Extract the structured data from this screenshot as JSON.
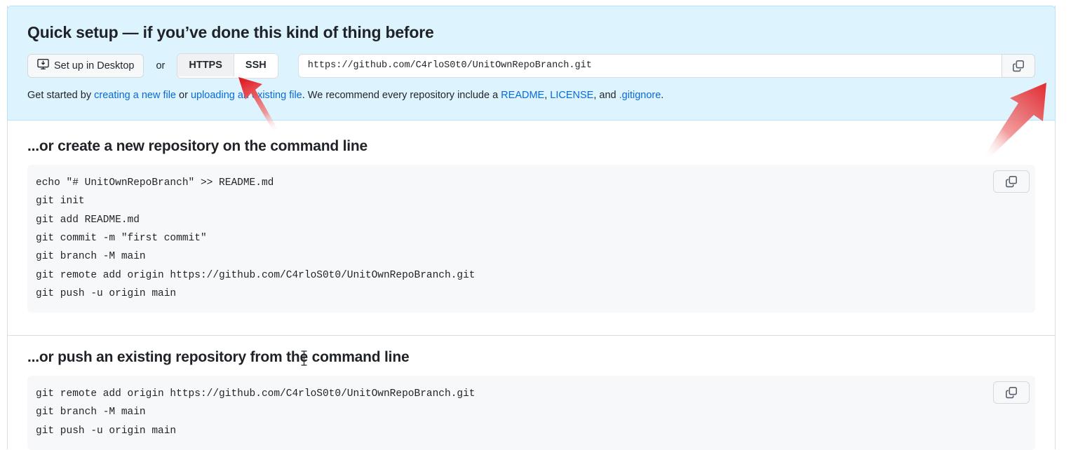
{
  "quick_setup": {
    "title": "Quick setup — if you’ve done this kind of thing before",
    "desktop_button": {
      "label": "Set up in Desktop",
      "icon": "desktop-download-icon"
    },
    "or_label": "or",
    "protocol_toggle": {
      "options": [
        "HTTPS",
        "SSH"
      ],
      "selected": "HTTPS"
    },
    "clone_url": {
      "value": "https://github.com/C4rloS0t0/UnitOwnRepoBranch.git",
      "placeholder": "https://github.com/"
    },
    "copy_icon": "copy-icon",
    "hint": {
      "lead": "Get started by ",
      "link_create": "creating a new file",
      "mid_1": " or ",
      "link_upload": "uploading an existing file",
      "mid_2": ". We recommend every repository include a ",
      "link_readme": "README",
      "comma_1": ", ",
      "link_license": "LICENSE",
      "mid_3": ", and ",
      "link_gitignore": ".gitignore",
      "end": "."
    }
  },
  "sections": [
    {
      "title": "...or create a new repository on the command line",
      "copy_icon": "copy-icon",
      "lines": [
        "echo \"# UnitOwnRepoBranch\" >> README.md",
        "git init",
        "git add README.md",
        "git commit -m \"first commit\"",
        "git branch -M main",
        "git remote add origin https://github.com/C4rloS0t0/UnitOwnRepoBranch.git",
        "git push -u origin main"
      ]
    },
    {
      "title": "...or push an existing repository from the command line",
      "copy_icon": "copy-icon",
      "lines": [
        "git remote add origin https://github.com/C4rloS0t0/UnitOwnRepoBranch.git",
        "git branch -M main",
        "git push -u origin main"
      ]
    }
  ],
  "annotations": {
    "arrow_color": "#e8232a",
    "arrow_to_copy_button": "points at clone URL copy button",
    "arrow_to_https_button": "points at HTTPS protocol toggle"
  },
  "colors": {
    "panel_background": "#ddf4ff",
    "panel_border": "#b6e3ff",
    "code_background": "#f6f8fa",
    "link": "#0969da",
    "text": "#1f2328",
    "border": "#d8dee4"
  }
}
